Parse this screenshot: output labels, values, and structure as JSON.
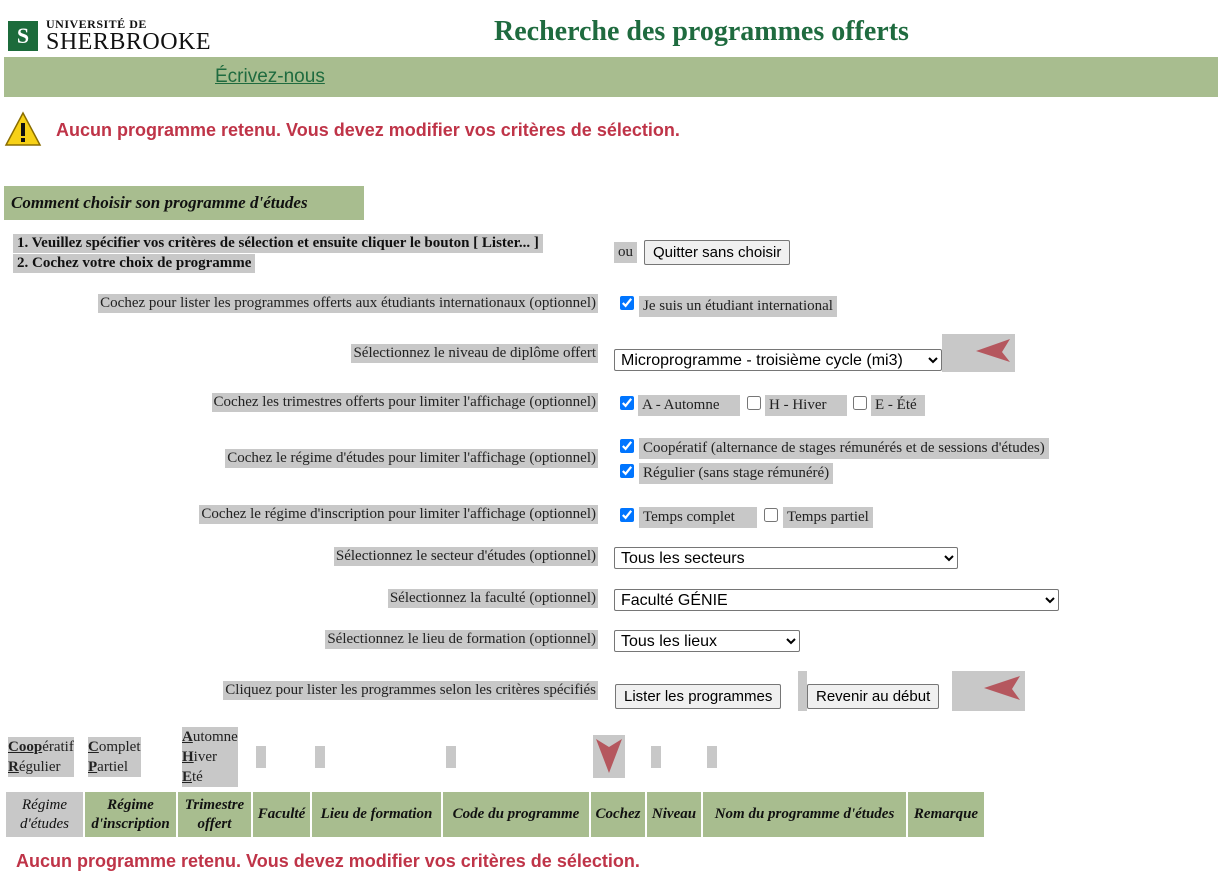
{
  "header": {
    "logo_line1": "UNIVERSITÉ DE",
    "logo_line2": "SHERBROOKE",
    "logo_mark": "S",
    "title": "Recherche des programmes offerts",
    "write_link": "Écrivez-nous"
  },
  "error_message": "Aucun programme retenu. Vous devez modifier vos critères de sélection.",
  "howto": "Comment choisir son programme d'études",
  "instructions": {
    "step1": "1. Veuillez spécifier vos critères de sélection et ensuite cliquer le bouton [ Lister... ]",
    "step2": "2. Cochez votre choix de programme",
    "or": "ou",
    "quit_button": "Quitter sans choisir"
  },
  "form": {
    "international_label": "Cochez pour lister les programmes offerts aux étudiants internationaux (optionnel)",
    "international_option": "Je suis un étudiant international",
    "degree_label": "Sélectionnez le niveau de diplôme offert",
    "degree_value": "Microprogramme - troisième cycle (mi3)",
    "terms_label": "Cochez les trimestres offerts pour limiter l'affichage (optionnel)",
    "terms": [
      {
        "label": "A - Automne",
        "checked": true
      },
      {
        "label": "H - Hiver",
        "checked": false
      },
      {
        "label": "E - Été",
        "checked": false
      }
    ],
    "regime_label": "Cochez le régime d'études pour limiter l'affichage (optionnel)",
    "regime_coop": "Coopératif  (alternance de stages rémunérés et de sessions d'études)",
    "regime_regular": "Régulier (sans stage rémunéré)",
    "enrol_label": "Cochez le régime d'inscription pour limiter l'affichage (optionnel)",
    "enrol_full": "Temps complet",
    "enrol_part": "Temps partiel",
    "sector_label": "Sélectionnez le secteur d'études (optionnel)",
    "sector_value": "Tous les secteurs",
    "faculty_label": "Sélectionnez la faculté (optionnel)",
    "faculty_value": "Faculté GÉNIE",
    "location_label": "Sélectionnez le lieu de formation (optionnel)",
    "location_value": "Tous les lieux",
    "list_label": "Cliquez pour lister les programmes selon les critères spécifiés",
    "list_button": "Lister les programmes",
    "reset_button": "Revenir au début"
  },
  "legend": {
    "coop_bold": "Coop",
    "coop_rest": "ératif",
    "reg_bold": "R",
    "reg_rest": "égulier",
    "comp_bold": "C",
    "comp_rest": "omplet",
    "part_bold": "P",
    "part_rest": "artiel",
    "aut_bold": "A",
    "aut_rest": "utomne",
    "hiv_bold": "H",
    "hiv_rest": "iver",
    "ete_bold": "E",
    "ete_rest": "té"
  },
  "table_headers": [
    "Régime d'études",
    "Régime d'inscription",
    "Trimestre offert",
    "Faculté",
    "Lieu de formation",
    "Code du programme",
    "Cochez",
    "Niveau",
    "Nom du programme d'études",
    "Remarque"
  ],
  "colors": {
    "accent_green": "#a8bd8f",
    "title_green": "#1f6b3f",
    "error_red": "#bf3448",
    "arrow_red": "#b5575e"
  }
}
